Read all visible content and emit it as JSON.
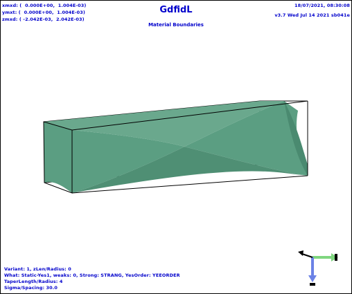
{
  "header": {
    "ranges": [
      "xmxd: (  0.000E+00,  1.004E-03)",
      "ymxt: (  0.000E+00,  1.004E-03)",
      "zmxd: ( -2.042E-03,  2.042E-03)"
    ],
    "title": "GdfidL",
    "subtitle": "Material Boundaries",
    "date": "18/07/2021, 08:30:08",
    "version": "v3.7 Wed Jul 14 2021 sb041e"
  },
  "info_lines": [
    "Variant: 1, zLen/Radius: 0",
    "What: Static-Yes1, weaks: 0, Strong: STRANG, YesOrder: YEEORDER",
    "TaperLength/Radius: 4",
    "Sigma/Spacing: 30.0"
  ],
  "colors": {
    "text": "#0000cc",
    "surface": "#5b9e82",
    "box": "#000000",
    "axis_x": "#7fd67f",
    "axis_y": "#6b82e6",
    "axis_z": "#000000"
  },
  "icons": {
    "axes": "coordinate-axes-icon"
  }
}
